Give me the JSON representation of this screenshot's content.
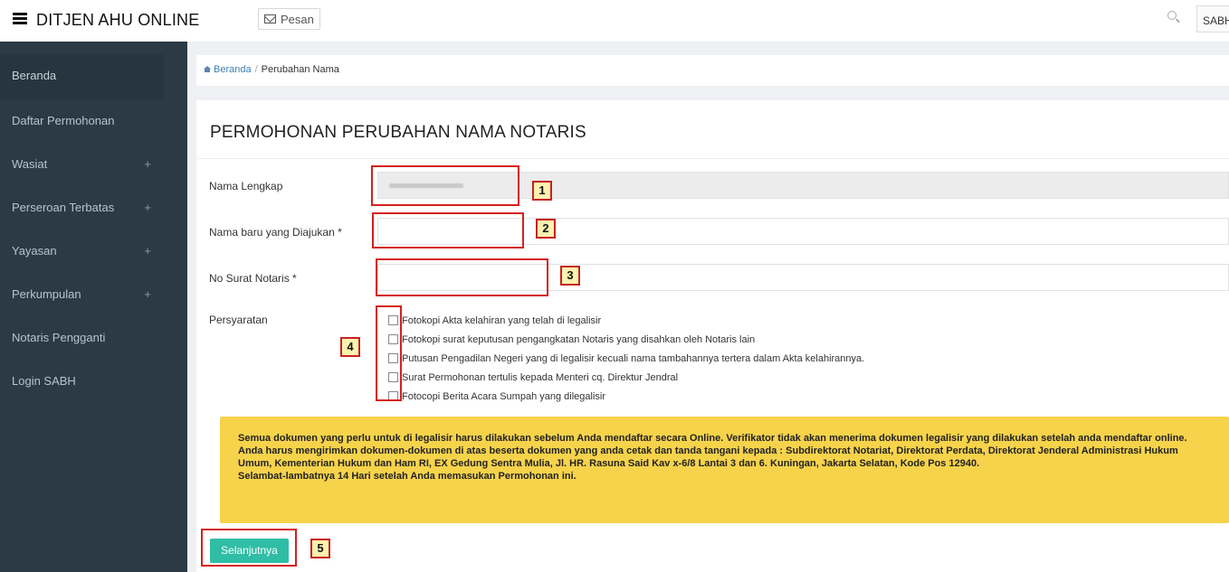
{
  "header": {
    "brand": "DITJEN AHU ONLINE",
    "message_button": "Pesan",
    "user_label": "SABH"
  },
  "sidebar": {
    "items": [
      {
        "label": "Beranda",
        "expandable": false
      },
      {
        "label": "Daftar Permohonan",
        "expandable": false
      },
      {
        "label": "Wasiat",
        "expandable": true
      },
      {
        "label": "Perseroan Terbatas",
        "expandable": true
      },
      {
        "label": "Yayasan",
        "expandable": true
      },
      {
        "label": "Perkumpulan",
        "expandable": true
      },
      {
        "label": "Notaris Pengganti",
        "expandable": false
      },
      {
        "label": "Login SABH",
        "expandable": false
      }
    ],
    "expand_symbol": "+"
  },
  "breadcrumb": {
    "home": "Beranda",
    "separator": "/",
    "current": "Perubahan Nama"
  },
  "form": {
    "title": "PERMOHONAN PERUBAHAN NAMA NOTARIS",
    "fields": {
      "full_name_label": "Nama Lengkap",
      "new_name_label": "Nama baru yang Diajukan *",
      "letter_no_label": "No Surat Notaris *",
      "requirements_label": "Persyaratan"
    },
    "requirements": [
      "Fotokopi Akta kelahiran yang telah di legalisir",
      "Fotokopi surat keputusan pengangkatan Notaris yang disahkan oleh Notaris lain",
      "Putusan Pengadilan Negeri yang di legalisir kecuali nama tambahannya tertera dalam Akta kelahirannya.",
      "Surat Permohonan tertulis kepada Menteri cq. Direktur Jendral",
      "Fotocopi Berita Acara Sumpah yang dilegalisir"
    ],
    "note_line1": "Semua dokumen yang perlu untuk di legalisir harus dilakukan sebelum Anda mendaftar secara Online. Verifikator tidak akan menerima dokumen legalisir yang dilakukan setelah anda mendaftar online.",
    "note_line2": "Anda harus mengirimkan dokumen-dokumen di atas beserta dokumen yang anda cetak dan tanda tangani kepada : Subdirektorat Notariat, Direktorat Perdata, Direktorat Jenderal Administrasi Hukum Umum, Kementerian Hukum dan Ham RI, EX Gedung Sentra Mulia, Jl. HR. Rasuna Said Kav x-6/8 Lantai 3 dan 6. Kuningan, Jakarta Selatan, Kode Pos 12940.",
    "note_line3": "Selambat-lambatnya 14 Hari setelah Anda memasukan Permohonan ini.",
    "next_button": "Selanjutnya"
  },
  "annotations": [
    "1",
    "2",
    "3",
    "4",
    "5"
  ],
  "colors": {
    "sidebar_bg": "#2b3a45",
    "content_bg": "#eef0f4",
    "note_bg": "#f6d34a",
    "button_bg": "#2fbda6",
    "highlight": "#d51f1f"
  }
}
